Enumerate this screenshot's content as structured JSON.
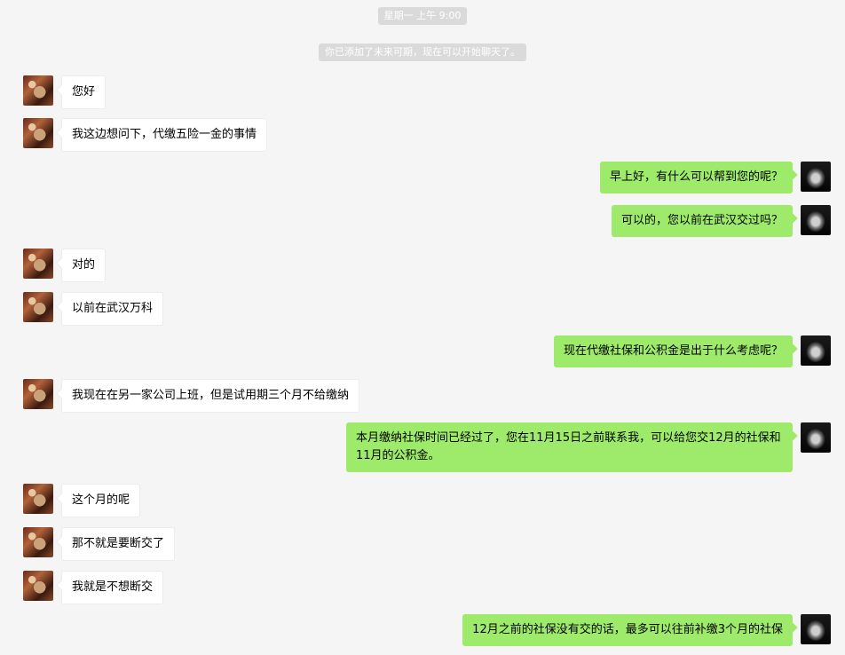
{
  "timestamp": "星期一 上午 9:00",
  "system_notice": "你已添加了未来可期，现在可以开始聊天了。",
  "messages": [
    {
      "from": "contact",
      "text": "您好"
    },
    {
      "from": "contact",
      "text": "我这边想问下，代缴五险一金的事情"
    },
    {
      "from": "me",
      "text": "早上好，有什么可以帮到您的呢？"
    },
    {
      "from": "me",
      "text": "可以的，您以前在武汉交过吗？"
    },
    {
      "from": "contact",
      "text": "对的"
    },
    {
      "from": "contact",
      "text": "以前在武汉万科"
    },
    {
      "from": "me",
      "text": "现在代缴社保和公积金是出于什么考虑呢？"
    },
    {
      "from": "contact",
      "text": "我现在在另一家公司上班，但是试用期三个月不给缴纳"
    },
    {
      "from": "me",
      "text": "本月缴纳社保时间已经过了，您在11月15日之前联系我，可以给您交12月的社保和11月的公积金。"
    },
    {
      "from": "contact",
      "text": "这个月的呢"
    },
    {
      "from": "contact",
      "text": "那不就是要断交了"
    },
    {
      "from": "contact",
      "text": "我就是不想断交"
    },
    {
      "from": "me",
      "text": "12月之前的社保没有交的话，最多可以往前补缴3个月的社保"
    }
  ]
}
